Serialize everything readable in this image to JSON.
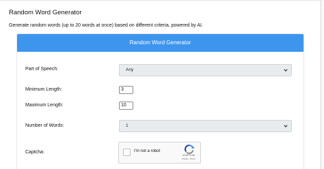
{
  "page": {
    "title": "Random Word Generator",
    "description": "Generate random words (up to 20 words at once) based on different criteria, powered by AI."
  },
  "form": {
    "header": "Random Word Generator",
    "part_of_speech": {
      "label": "Part of Speech:",
      "value": "Any"
    },
    "min_length": {
      "label": "Minimum Length:",
      "value": "3"
    },
    "max_length": {
      "label": "Maximum Length:",
      "value": "10"
    },
    "num_words": {
      "label": "Number of Words:",
      "value": "1"
    },
    "captcha": {
      "label": "Captcha:",
      "checkbox_label": "I'm not a robot",
      "brand": "reCAPTCHA",
      "links": "Privacy - Terms"
    }
  },
  "icons": {
    "dropdown": "chevron-down-icon",
    "captcha_logo": "recaptcha-logo-icon"
  },
  "colors": {
    "header_bg": "#3d95ee",
    "header_text": "#ffffff",
    "select_bg": "#e9ecef"
  }
}
